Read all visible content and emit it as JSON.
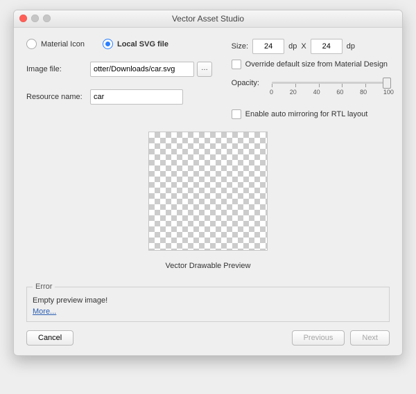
{
  "window": {
    "title": "Vector Asset Studio"
  },
  "source": {
    "material_label": "Material Icon",
    "svg_label": "Local SVG file",
    "selected": "svg"
  },
  "image_file": {
    "label": "Image file:",
    "value": "otter/Downloads/car.svg"
  },
  "resource_name": {
    "label": "Resource name:",
    "value": "car"
  },
  "size": {
    "label": "Size:",
    "width": "24",
    "height": "24",
    "unit": "dp",
    "sep": "X"
  },
  "override": {
    "label": "Override default size from Material Design"
  },
  "opacity": {
    "label": "Opacity:",
    "value": 100,
    "ticks": [
      "0",
      "20",
      "40",
      "60",
      "80",
      "100"
    ]
  },
  "rtl": {
    "label": "Enable auto mirroring for RTL layout"
  },
  "preview": {
    "label": "Vector Drawable Preview"
  },
  "error": {
    "legend": "Error",
    "message": "Empty preview image!",
    "more": "More..."
  },
  "buttons": {
    "cancel": "Cancel",
    "previous": "Previous",
    "next": "Next"
  }
}
